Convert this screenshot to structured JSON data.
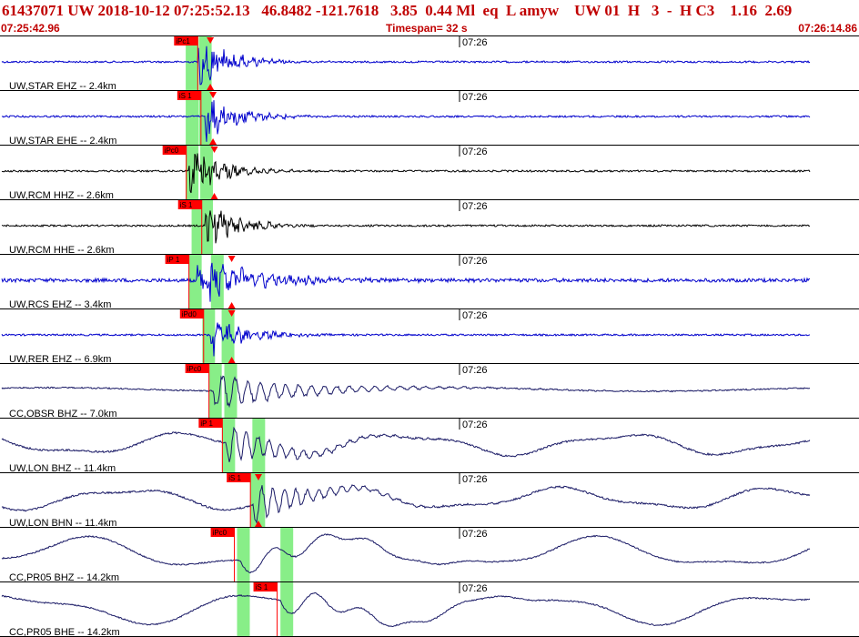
{
  "header": {
    "title": "61437071 UW 2018-10-12 07:25:52.13   46.8482 -121.7618   3.85  0.44 Ml  eq  L amyw    UW 01  H   3  -  H C3    1.16  2.69",
    "start_time": "07:25:42.96",
    "timespan": "Timespan=  32 s",
    "end_time": "07:26:14.86"
  },
  "colors": {
    "blue_trace": "#0000cc",
    "black_trace": "#000000",
    "navy_trace": "#1a1a66",
    "pick_flag": "#ff0000",
    "pick_window": "#88ee88",
    "title_text": "#c00000"
  },
  "traces": [
    {
      "label": "UW,STAR EHZ -- 2.4km",
      "time_label": "07:26",
      "color": "blue",
      "picks": [
        {
          "text": "iPc1",
          "t": 7.33
        }
      ],
      "windows": [
        6.88,
        7.85
      ],
      "markers": [
        7.8
      ],
      "amp": "burst",
      "onset": 7.33
    },
    {
      "label": "UW,STAR EHE -- 2.4km",
      "time_label": "07:26",
      "color": "blue",
      "picks": [
        {
          "text": "iS 1",
          "t": 7.45
        }
      ],
      "windows": [
        6.88,
        7.85
      ],
      "markers": [
        7.9
      ],
      "amp": "burst",
      "onset": 7.6
    },
    {
      "label": "UW,RCM HHZ -- 2.6km",
      "time_label": "07:26",
      "color": "black",
      "picks": [
        {
          "text": "iPc0",
          "t": 6.9
        }
      ],
      "windows": [
        6.88,
        7.9
      ],
      "markers": [
        7.95
      ],
      "amp": "burst",
      "onset": 7.0
    },
    {
      "label": "UW,RCM HHE -- 2.6km",
      "time_label": "07:26",
      "color": "black",
      "picks": [
        {
          "text": "iS 1",
          "t": 7.48
        }
      ],
      "windows": [
        7.1,
        7.9
      ],
      "markers": [],
      "amp": "burst",
      "onset": 7.6
    },
    {
      "label": "UW,RCS EHZ -- 3.4km",
      "time_label": "07:26",
      "color": "blue",
      "picks": [
        {
          "text": "iP 1",
          "t": 7.0
        }
      ],
      "windows": [
        7.0,
        8.3
      ],
      "markers": [
        8.6
      ],
      "amp": "noisy",
      "onset": 7.3
    },
    {
      "label": "UW,RER EHZ -- 6.9km",
      "time_label": "07:26",
      "color": "blue",
      "picks": [
        {
          "text": "iPd0",
          "t": 7.55
        }
      ],
      "windows": [
        7.5,
        8.7
      ],
      "markers": [
        8.6
      ],
      "amp": "burst",
      "onset": 7.8
    },
    {
      "label": "CC,OBSR BHZ -- 7.0km",
      "time_label": "07:26",
      "color": "navy",
      "picks": [
        {
          "text": "iPc0",
          "t": 7.75
        }
      ],
      "windows": [
        7.75,
        8.8
      ],
      "markers": [],
      "amp": "long",
      "onset": 7.9
    },
    {
      "label": "UW,LON BHZ -- 11.4km",
      "time_label": "07:26",
      "color": "navy",
      "picks": [
        {
          "text": "iP 1",
          "t": 8.25
        }
      ],
      "windows": [
        8.25,
        9.85
      ],
      "markers": [],
      "amp": "wavy",
      "onset": 8.4
    },
    {
      "label": "UW,LON BHN -- 11.4km",
      "time_label": "07:26",
      "color": "navy",
      "picks": [
        {
          "text": "iS 1",
          "t": 9.3
        }
      ],
      "windows": [
        9.3,
        9.85
      ],
      "markers": [
        9.6
      ],
      "amp": "wavy",
      "onset": 9.4
    },
    {
      "label": "CC,PR05 BHZ -- 14.2km",
      "time_label": "07:26",
      "color": "navy",
      "picks": [
        {
          "text": "iPc0",
          "t": 8.7
        }
      ],
      "windows": [
        8.8,
        10.9
      ],
      "markers": [],
      "amp": "swell",
      "onset": 8.9
    },
    {
      "label": "CC,PR05 BHE -- 14.2km",
      "time_label": "07:26",
      "color": "navy",
      "picks": [
        {
          "text": "iS 1",
          "t": 10.3
        }
      ],
      "windows": [
        8.8,
        10.9
      ],
      "markers": [],
      "amp": "swell",
      "onset": 10.4
    }
  ]
}
